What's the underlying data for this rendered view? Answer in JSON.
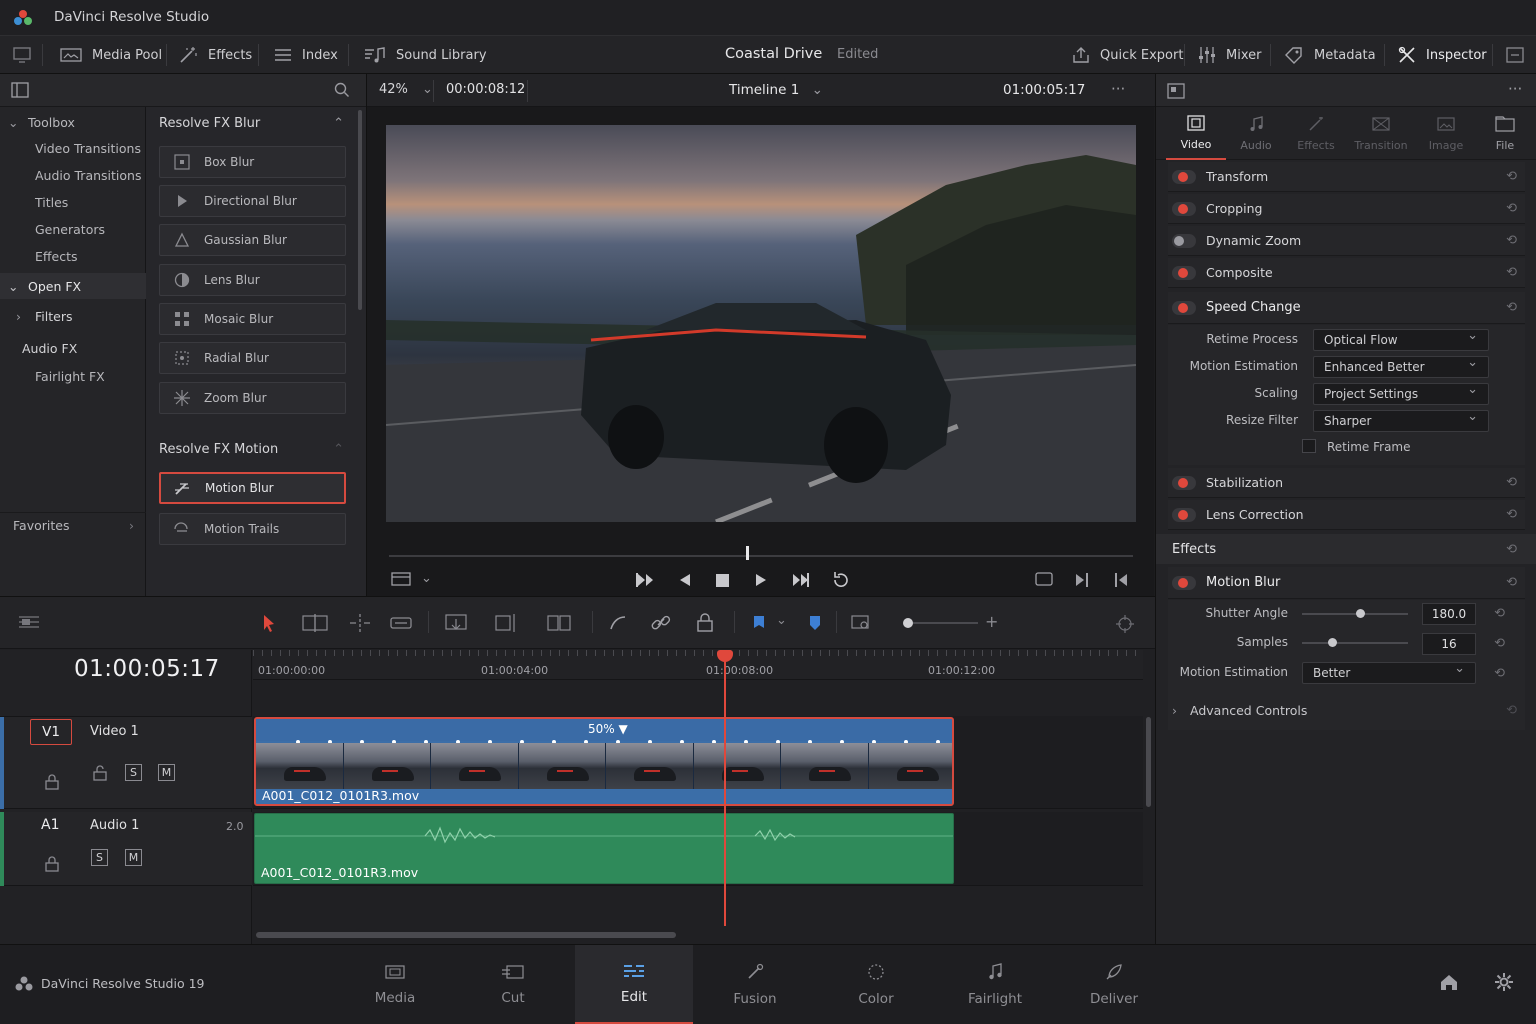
{
  "app": {
    "title": "DaVinci Resolve Studio"
  },
  "toolbar": {
    "media_pool": "Media Pool",
    "effects": "Effects",
    "index": "Index",
    "sound_library": "Sound Library",
    "project_name": "Coastal Drive",
    "project_status": "Edited",
    "quick_export": "Quick Export",
    "mixer": "Mixer",
    "metadata": "Metadata",
    "inspector": "Inspector"
  },
  "viewer": {
    "zoom": "42%",
    "source_tc": "00:00:08:12",
    "timeline_name": "Timeline 1",
    "record_tc": "01:00:05:17",
    "more": "···"
  },
  "toolbox": {
    "header": "Toolbox",
    "items": [
      "Video Transitions",
      "Audio Transitions",
      "Titles",
      "Generators",
      "Effects"
    ],
    "open_fx": "Open FX",
    "filters": "Filters",
    "audio_fx": "Audio FX",
    "fairlight_fx": "Fairlight FX",
    "favorites": "Favorites"
  },
  "fx": {
    "group1": "Resolve FX Blur",
    "blur_items": [
      "Box Blur",
      "Directional Blur",
      "Gaussian Blur",
      "Lens Blur",
      "Mosaic Blur",
      "Radial Blur",
      "Zoom Blur"
    ],
    "group2": "Resolve FX Motion",
    "motion_items": [
      "Motion Blur",
      "Motion Trails"
    ]
  },
  "inspector": {
    "tabs": [
      "Video",
      "Audio",
      "Effects",
      "Transition",
      "Image",
      "File"
    ],
    "sections": [
      "Transform",
      "Cropping",
      "Dynamic Zoom",
      "Composite",
      "Speed Change"
    ],
    "speed": {
      "retime_process_label": "Retime Process",
      "retime_process": "Optical Flow",
      "motion_est_label": "Motion Estimation",
      "motion_est": "Enhanced Better",
      "scaling_label": "Scaling",
      "scaling": "Project Settings",
      "resize_filter_label": "Resize Filter",
      "resize_filter": "Sharper",
      "retime_frame": "Retime Frame"
    },
    "stabilization": "Stabilization",
    "lens_correction": "Lens Correction",
    "effects_header": "Effects",
    "motion_blur": {
      "title": "Motion Blur",
      "shutter_label": "Shutter Angle",
      "shutter_value": "180.0",
      "shutter_level": 0.55,
      "samples_label": "Samples",
      "samples_value": "16",
      "samples_level": 0.28,
      "motion_est_label": "Motion Estimation",
      "motion_est": "Better",
      "advanced": "Advanced Controls"
    }
  },
  "timeline": {
    "timecode": "01:00:05:17",
    "ruler": [
      "01:00:00:00",
      "01:00:04:00",
      "01:00:08:00",
      "01:00:12:00"
    ],
    "v1": {
      "id": "V1",
      "name": "Video 1",
      "s": "S",
      "m": "M"
    },
    "a1": {
      "id": "A1",
      "name": "Audio 1",
      "level": "2.0",
      "s": "S",
      "m": "M"
    },
    "clip_video": "A001_C012_0101R3.mov",
    "clip_audio": "A001_C012_0101R3.mov",
    "speed_badge": "50% ▼"
  },
  "pages": {
    "brand": "DaVinci Resolve Studio 19",
    "items": [
      "Media",
      "Cut",
      "Edit",
      "Fusion",
      "Color",
      "Fairlight",
      "Deliver"
    ],
    "active": "Edit"
  },
  "colors": {
    "accent": "#d54a3f",
    "video_clip": "#3b6ea8",
    "audio_clip": "#2f8a5a"
  }
}
